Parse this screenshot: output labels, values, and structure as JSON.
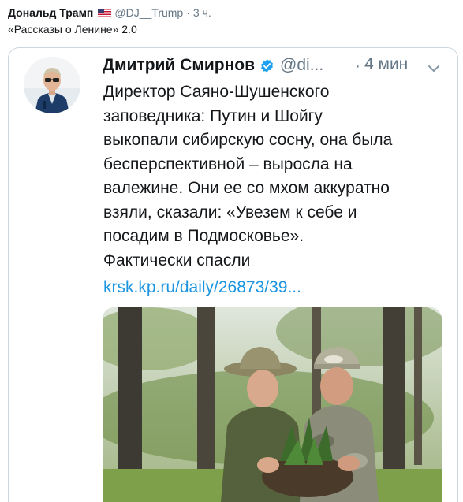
{
  "outer_tweet": {
    "author_name": "Дональд Трамп",
    "flag_icon": "us-flag-icon",
    "handle": "@DJ__Trump",
    "separator": "·",
    "time": "3 ч.",
    "text": "«Рассказы о Ленине» 2.0"
  },
  "quoted_tweet": {
    "author_name": "Дмитрий Смирнов",
    "verified_icon": "verified-badge-icon",
    "handle": "@di...",
    "separator": "·",
    "time": "4 мин",
    "menu_icon": "chevron-down-icon",
    "body_lines": [
      "Директор Саяно-Шушенского",
      "заповедника: Путин и Шойгу",
      "выкопали сибирскую сосну, она была",
      "бесперспективной – выросла на",
      "валежине. Они ее со мхом аккуратно",
      "взяли, сказали: «Увезем к себе и",
      "посадим в Подмосковье».",
      "Фактически спасли"
    ],
    "link": "krsk.kp.ru/daily/26873/39..."
  },
  "colors": {
    "text": "#14171a",
    "secondary": "#657786",
    "link": "#1b95e0",
    "verified": "#1da1f2",
    "border": "#ccd6dd"
  }
}
